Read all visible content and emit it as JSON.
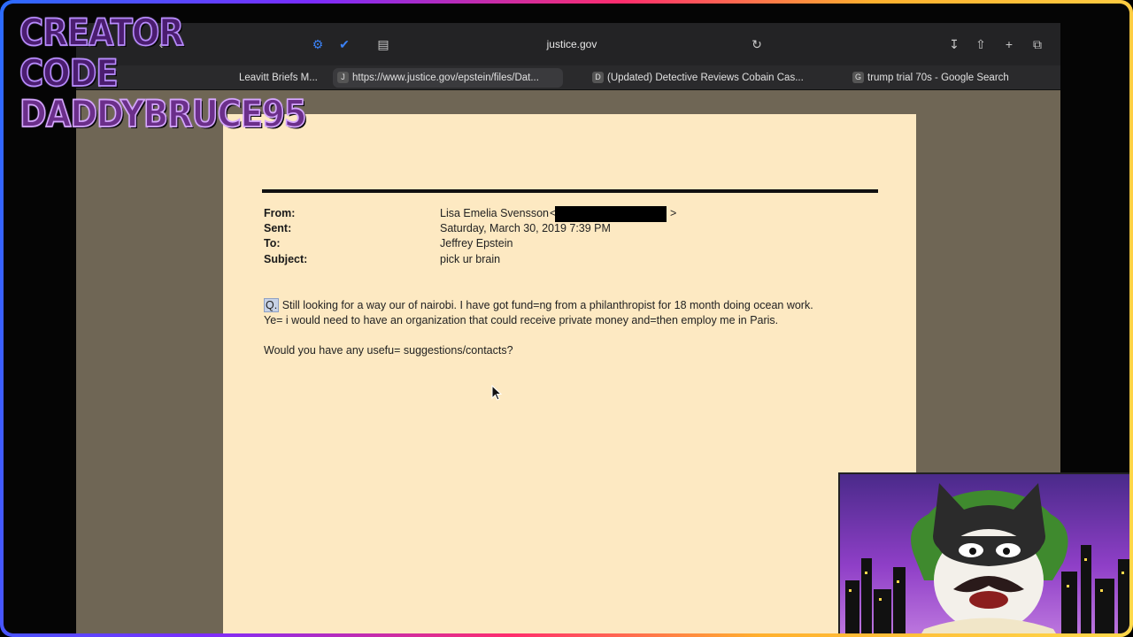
{
  "overlay": {
    "creator_line1": "CREATOR CODE",
    "creator_line2": "DADDYBRUCE95"
  },
  "browser": {
    "url": "justice.gov",
    "tabs": [
      {
        "label": "Leavitt Briefs M...",
        "favicon": ""
      },
      {
        "label": "https://www.justice.gov/epstein/files/Dat...",
        "favicon": "J"
      },
      {
        "label": "(Updated) Detective Reviews Cobain Cas...",
        "favicon": "D"
      },
      {
        "label": "trump trial 70s - Google Search",
        "favicon": "G"
      }
    ],
    "icons": {
      "reload": "reload-icon",
      "download": "download-icon",
      "share": "share-icon",
      "new_tab": "plus-icon",
      "tab_overview": "tabs-icon"
    }
  },
  "email": {
    "from_label": "From:",
    "from_value": "Lisa Emelia Svensson",
    "from_open": "<",
    "from_close": ">",
    "sent_label": "Sent:",
    "sent_value": "Saturday, March 30, 2019 7:39 PM",
    "to_label": "To:",
    "to_value": "Jeffrey Epstein",
    "subject_label": "Subject:",
    "subject_value": "pick ur brain",
    "body_marker": "Q.",
    "body_line1": "Still looking for a way our of nairobi. I have got fund=ng from a philanthropist  for 18 month doing ocean work.",
    "body_line2": "Ye= i would need to have an organization that could receive private money and=then employ me in Paris.",
    "body_line3": "Would you have any usefu= suggestions/contacts?"
  },
  "colors": {
    "page_bg": "#fde9c2",
    "viewer_bg": "#6f6655",
    "accent_blue": "#3b82f6"
  }
}
